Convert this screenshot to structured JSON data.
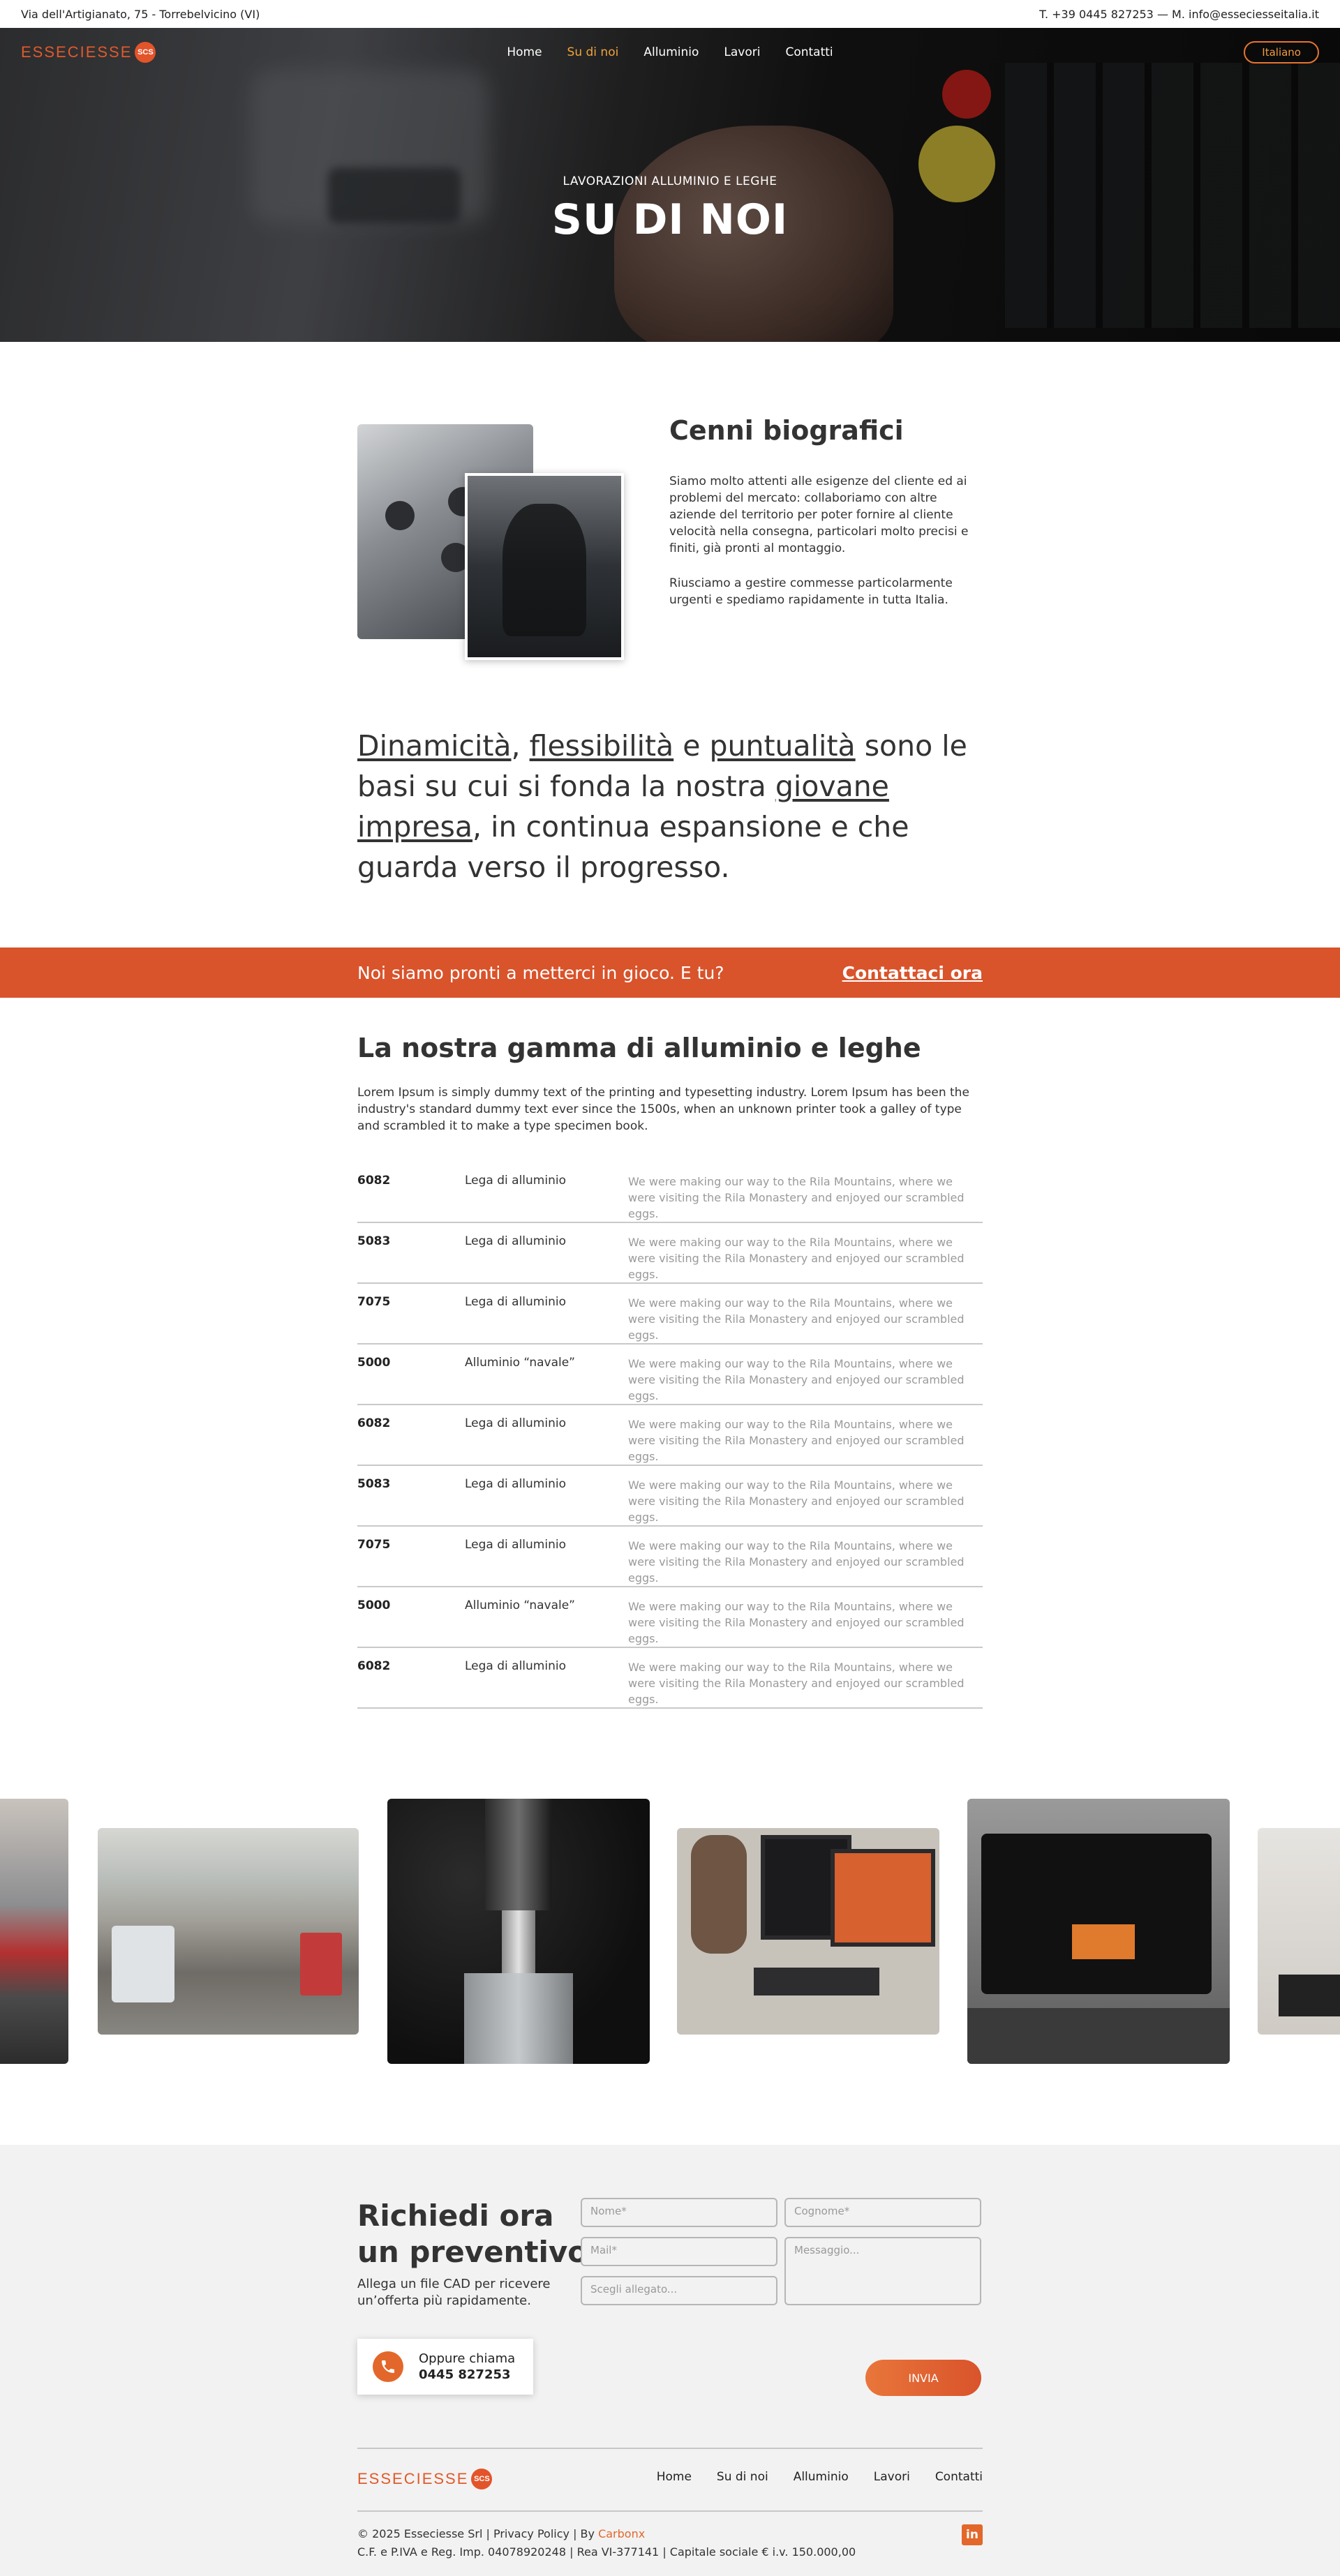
{
  "topbar": {
    "address": "Via dell'Artigianato, 75 - Torrebelvicino (VI)",
    "contact": "T. +39 0445 827253 — M. info@esseciesseitalia.it"
  },
  "logo": {
    "text": "ESSECIESSE",
    "mark": "SCS"
  },
  "nav": {
    "items": [
      "Home",
      "Su di noi",
      "Alluminio",
      "Lavori",
      "Contatti"
    ],
    "active": "Su di noi",
    "language": "Italiano"
  },
  "hero": {
    "kicker": "LAVORAZIONI ALLUMINIO E LEGHE",
    "title": "SU DI NOI"
  },
  "bio": {
    "title": "Cenni biografici",
    "p1": "Siamo molto attenti alle esigenze del cliente ed ai problemi del mercato: collaboriamo con altre aziende del territorio per poter fornire al cliente velocità nella consegna, particolari molto precisi e finiti, già pronti al montaggio.",
    "p2": "Riusciamo a gestire commesse particolarmente urgenti e spediamo rapidamente in tutta Italia."
  },
  "statement": {
    "w1": "Dinamicità",
    "sep1": ", ",
    "w2": "flessibilità",
    "sep2": " e ",
    "w3": "puntualità",
    "mid": " sono le basi su cui si fonda la nostra ",
    "w4": "giovane impresa",
    "end": ", in continua espansione e che guarda verso il progresso."
  },
  "cta": {
    "text": "Noi siamo pronti a metterci in gioco. E tu?",
    "link": "Contattaci ora"
  },
  "gamma": {
    "title": "La nostra gamma di alluminio e leghe",
    "intro": "Lorem Ipsum is simply dummy text of the printing and typesetting industry. Lorem Ipsum has been the industry's standard dummy text ever since the 1500s, when an unknown printer took a galley of type and scrambled it to make a type specimen book.",
    "rows": [
      {
        "code": "6082",
        "name": "Lega di alluminio",
        "desc": "We were making our way to the Rila Mountains, where we were visiting the Rila Monastery and enjoyed our scrambled eggs."
      },
      {
        "code": "5083",
        "name": "Lega di alluminio",
        "desc": "We were making our way to the Rila Mountains, where we were visiting the Rila Monastery and enjoyed our scrambled eggs."
      },
      {
        "code": "7075",
        "name": "Lega di alluminio",
        "desc": "We were making our way to the Rila Mountains, where we were visiting the Rila Monastery and enjoyed our scrambled eggs."
      },
      {
        "code": "5000",
        "name": "Alluminio “navale”",
        "desc": "We were making our way to the Rila Mountains, where we were visiting the Rila Monastery and enjoyed our scrambled eggs."
      },
      {
        "code": "6082",
        "name": "Lega di alluminio",
        "desc": "We were making our way to the Rila Mountains, where we were visiting the Rila Monastery and enjoyed our scrambled eggs."
      },
      {
        "code": "5083",
        "name": "Lega di alluminio",
        "desc": "We were making our way to the Rila Mountains, where we were visiting the Rila Monastery and enjoyed our scrambled eggs."
      },
      {
        "code": "7075",
        "name": "Lega di alluminio",
        "desc": "We were making our way to the Rila Mountains, where we were visiting the Rila Monastery and enjoyed our scrambled eggs."
      },
      {
        "code": "5000",
        "name": "Alluminio “navale”",
        "desc": "We were making our way to the Rila Mountains, where we were visiting the Rila Monastery and enjoyed our scrambled eggs."
      },
      {
        "code": "6082",
        "name": "Lega di alluminio",
        "desc": "We were making our way to the Rila Mountains, where we were visiting the Rila Monastery and enjoyed our scrambled eggs."
      }
    ]
  },
  "quote": {
    "title_line1": "Richiedi ora",
    "title_line2": "un preventivo",
    "subtitle": "Allega un file CAD per ricevere un’offerta più rapidamente.",
    "call_label": "Oppure chiama",
    "call_number": "0445 827253",
    "fields": {
      "name": "Nome*",
      "surname": "Cognome*",
      "mail": "Mail*",
      "message": "Messaggio...",
      "attachment": "Scegli allegato..."
    },
    "submit": "INVIA"
  },
  "footer": {
    "links": [
      "Home",
      "Su di noi",
      "Alluminio",
      "Lavori",
      "Contatti"
    ],
    "copyright_prefix": "© 2025 Esseciesse Srl | Privacy Policy | By ",
    "credit": "Carbonx",
    "legal": "C.F. e P.IVA e Reg. Imp. 04078920248 | Rea VI-377141 | Capitale sociale € i.v. 150.000,00",
    "social": "in"
  },
  "colors": {
    "accent": "#d9532b",
    "accent_light": "#e3672a",
    "nav_active": "#f2a23a",
    "footer_bg": "#f2f2f2"
  },
  "icons": [
    "phone-icon",
    "linkedin-icon",
    "logo-mark-icon"
  ]
}
